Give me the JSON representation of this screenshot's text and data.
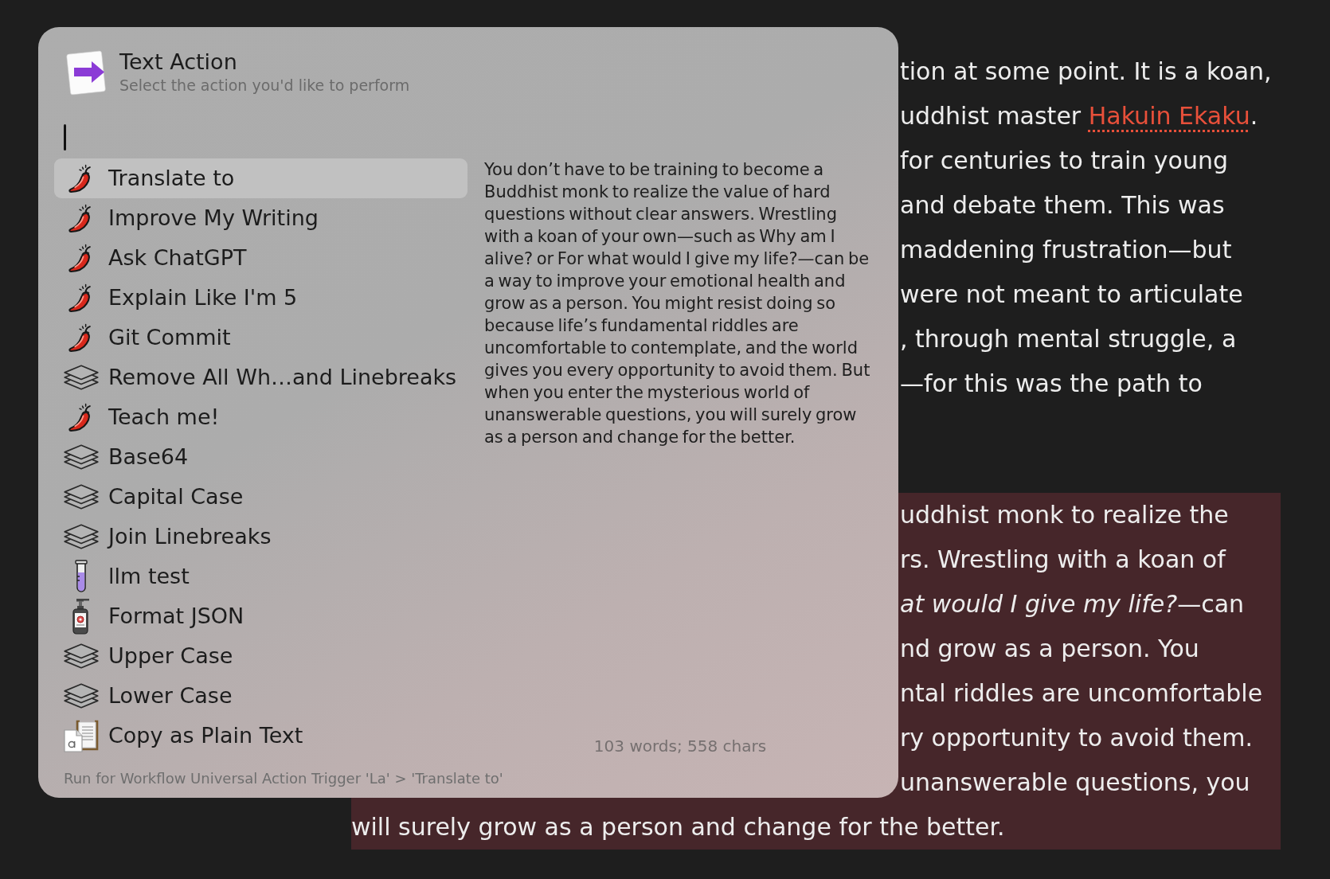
{
  "action_panel": {
    "title": "Text Action",
    "subtitle": "Select the action you'd like to perform",
    "actions": [
      {
        "label": "Translate to",
        "kind": "pepper",
        "selected": true
      },
      {
        "label": "Improve My Writing",
        "kind": "pepper",
        "selected": false
      },
      {
        "label": "Ask ChatGPT",
        "kind": "pepper",
        "selected": false
      },
      {
        "label": "Explain Like I'm 5",
        "kind": "pepper",
        "selected": false
      },
      {
        "label": "Git Commit",
        "kind": "pepper",
        "selected": false
      },
      {
        "label": "Remove All Wh…and Linebreaks",
        "kind": "layers",
        "selected": false
      },
      {
        "label": "Teach me!",
        "kind": "pepper",
        "selected": false
      },
      {
        "label": "Base64",
        "kind": "layers",
        "selected": false
      },
      {
        "label": "Capital Case",
        "kind": "layers",
        "selected": false
      },
      {
        "label": "Join Linebreaks",
        "kind": "layers",
        "selected": false
      },
      {
        "label": "llm test",
        "kind": "tube",
        "selected": false
      },
      {
        "label": "Format JSON",
        "kind": "bottle",
        "selected": false
      },
      {
        "label": "Upper Case",
        "kind": "layers",
        "selected": false
      },
      {
        "label": "Lower Case",
        "kind": "layers",
        "selected": false
      },
      {
        "label": "Copy as Plain Text",
        "kind": "clipboard",
        "selected": false
      }
    ],
    "preview": {
      "text": "You don’t have to be training to become a Buddhist monk to realize the value of hard questions without clear answers. Wrestling with a koan of your own—such as Why am I alive? or For what would I give my life?—can be a way to improve your emotional health and grow as a person. You might resist doing so because life’s fundamental riddles are uncomfortable to contemplate, and the world gives you every opportunity to avoid them. But when you enter the mysterious world of unanswerable questions, you will surely grow as a person and change for the better.",
      "stats": "103 words; 558 chars"
    },
    "status": "Run for Workflow Universal Action Trigger 'La' > 'Translate to'"
  },
  "document": {
    "paragraphs": [
      {
        "selected": false,
        "lines": [
          {
            "text": "tion at some point. It is a koan,",
            "clipped": true
          },
          {
            "text": "uddhist master",
            "link": "Hakuin Ekaku",
            "after": ".",
            "clipped": true
          },
          {
            "text": "for centuries to train young",
            "clipped": true
          },
          {
            "text": "and debate them. This was",
            "clipped": true
          },
          {
            "text": "maddening frustration—but",
            "clipped": true
          },
          {
            "text": "were not meant to articulate",
            "clipped": true
          },
          {
            "text": ", through mental struggle, a",
            "clipped": true
          },
          {
            "text": "—for this was the path to",
            "clipped": true
          }
        ]
      },
      {
        "selected": true,
        "lines": [
          {
            "text": "uddhist monk to realize the",
            "clipped": true
          },
          {
            "text": "rs. Wrestling with a koan of",
            "clipped": true
          },
          {
            "text": "*at would I give my life?*—can",
            "clipped": true
          },
          {
            "text": "nd grow as a person. You",
            "clipped": true
          },
          {
            "text": "ntal riddles are uncomfortable",
            "clipped": true
          },
          {
            "text": "ry opportunity to avoid them.",
            "clipped": true
          },
          {
            "text": "unanswerable questions, you",
            "clipped": true
          },
          {
            "text": "will surely grow as a person and change for the better.",
            "clipped": false
          }
        ]
      }
    ]
  }
}
